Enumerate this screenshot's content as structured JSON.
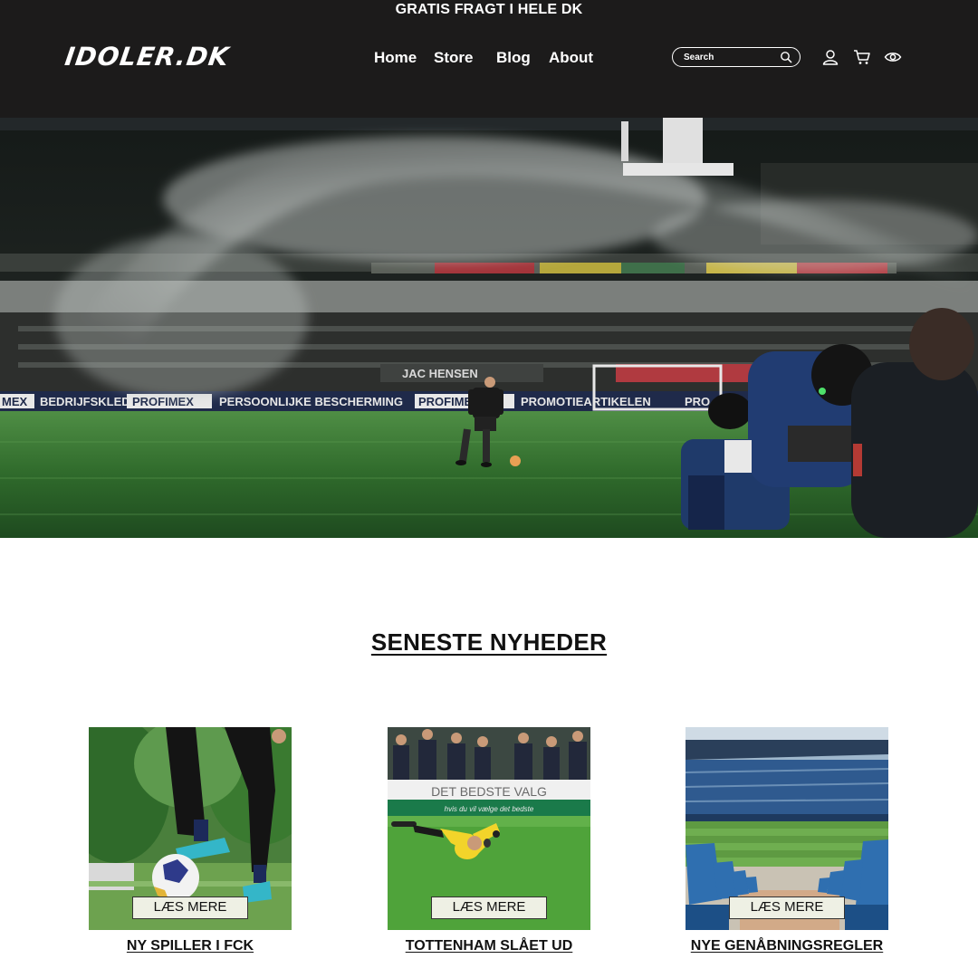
{
  "promo": {
    "text": "GRATIS FRAGT I HELE DK"
  },
  "brand": {
    "logo_text": "IDOLER.DK"
  },
  "nav": {
    "items": [
      {
        "label": "Home"
      },
      {
        "label": "Store"
      },
      {
        "label": "Blog"
      },
      {
        "label": "About"
      }
    ]
  },
  "search": {
    "placeholder": "Search",
    "icon": "search-icon"
  },
  "header_icons": [
    "user-icon",
    "cart-icon",
    "eye-icon"
  ],
  "hero": {
    "board_texts": [
      "MEX",
      "BEDRIJFSKLEDING",
      "PROFIMEX",
      "PERSOONLIJKE BESCHERMING",
      "PROFIMEX",
      "PROMOTIEARTIKELEN",
      "PRO"
    ],
    "upper_banner": "JAC HENSEN"
  },
  "news": {
    "title": "SENESTE NYHEDER",
    "cards": [
      {
        "title": "NY SPILLER I FCK",
        "button": "LÆS MERE"
      },
      {
        "title": "TOTTENHAM SLÅET UD",
        "button": "LÆS MERE",
        "banner_line1": "DET BEDSTE VALG",
        "banner_line2": "hvis du vil vælge det bedste"
      },
      {
        "title": "NYE GENÅBNINGSREGLER",
        "button": "LÆS MERE"
      }
    ]
  },
  "colors": {
    "header_bg": "#1c1b1b",
    "text_on_dark": "#ffffff",
    "button_bg": "#eef0e4",
    "pitch_green": "#3f8a3a"
  }
}
